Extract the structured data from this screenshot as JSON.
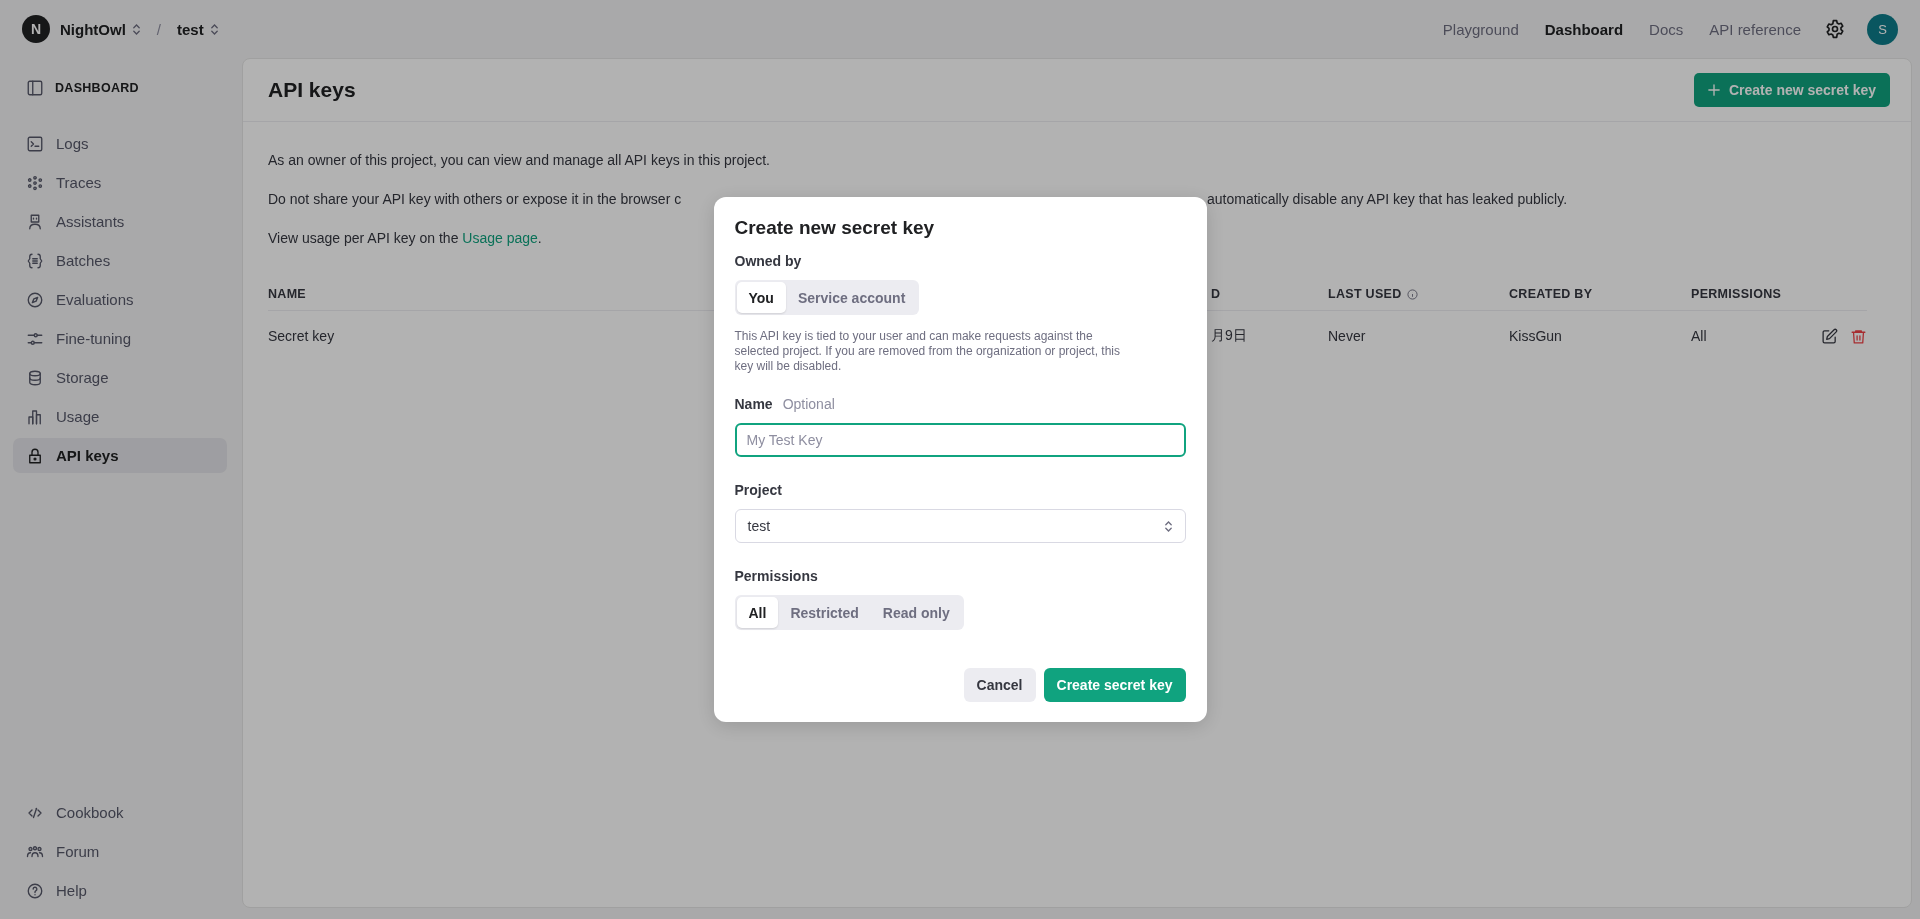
{
  "top_bar": {
    "org": {
      "initial": "N",
      "name": "NightOwl"
    },
    "separator": "/",
    "project": "test",
    "nav": [
      {
        "label": "Playground",
        "selected": false
      },
      {
        "label": "Dashboard",
        "selected": true
      },
      {
        "label": "Docs",
        "selected": false
      },
      {
        "label": "API reference",
        "selected": false
      }
    ],
    "avatar": "S"
  },
  "sidebar": {
    "heading": "DASHBOARD",
    "items": [
      {
        "label": "Logs",
        "selected": false
      },
      {
        "label": "Traces",
        "selected": false
      },
      {
        "label": "Assistants",
        "selected": false
      },
      {
        "label": "Batches",
        "selected": false
      },
      {
        "label": "Evaluations",
        "selected": false
      },
      {
        "label": "Fine-tuning",
        "selected": false
      },
      {
        "label": "Storage",
        "selected": false
      },
      {
        "label": "Usage",
        "selected": false
      },
      {
        "label": "API keys",
        "selected": true
      }
    ],
    "footer_items": [
      {
        "label": "Cookbook"
      },
      {
        "label": "Forum"
      },
      {
        "label": "Help"
      }
    ]
  },
  "page": {
    "title": "API keys",
    "create_button": "Create new secret key",
    "intro": "As an owner of this project, you can view and manage all API keys in this project.",
    "warning_left": "Do not share your API key with others or expose it in the browser c",
    "warning_right": "automatically disable any API key that has leaked publicly.",
    "usage_before": "View usage per API key on the ",
    "usage_link": "Usage page",
    "usage_after": "."
  },
  "table": {
    "columns": [
      "NAME",
      "D",
      "LAST USED",
      "CREATED BY",
      "PERMISSIONS"
    ],
    "rows": [
      {
        "cells": [
          "Secret key",
          "月9日",
          "Never",
          "KissGun",
          "All"
        ]
      }
    ]
  },
  "dialog": {
    "title": "Create new secret key",
    "owned_by": {
      "label": "Owned by",
      "options": [
        {
          "label": "You",
          "selected": true
        },
        {
          "label": "Service account",
          "selected": false
        }
      ]
    },
    "description": "This API key is tied to your user and can make requests against the selected project. If you are removed from the organization or project, this key will be disabled.",
    "name_field": {
      "label": "Name",
      "hint": "Optional",
      "placeholder": "My Test Key",
      "focused": true
    },
    "project_field": {
      "label": "Project",
      "value": "test"
    },
    "permissions": {
      "label": "Permissions",
      "options": [
        {
          "label": "All",
          "selected": true
        },
        {
          "label": "Restricted",
          "selected": false
        },
        {
          "label": "Read only",
          "selected": false
        }
      ]
    },
    "buttons": [
      {
        "label": "Cancel",
        "kind": "secondary"
      },
      {
        "label": "Create secret key",
        "kind": "primary"
      }
    ]
  }
}
